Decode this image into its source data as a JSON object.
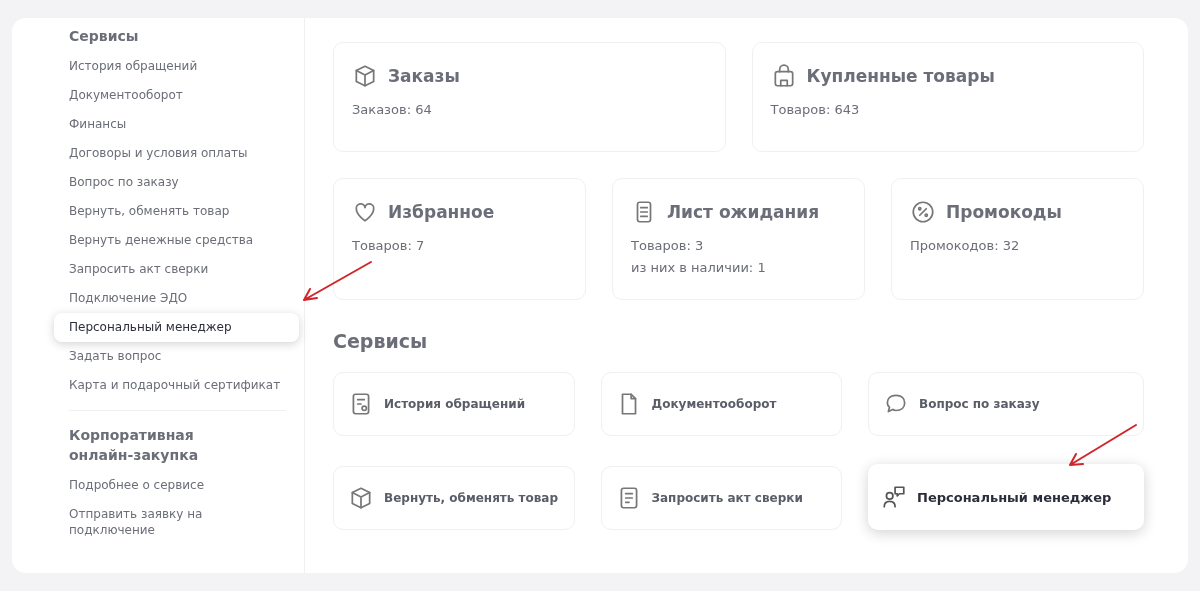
{
  "sidebar": {
    "groups": [
      {
        "title": "Сервисы",
        "highlighted": false,
        "items": [
          {
            "label": "История обращений",
            "highlighted": false
          },
          {
            "label": "Документооборот",
            "highlighted": false
          },
          {
            "label": "Финансы",
            "highlighted": false
          },
          {
            "label": "Договоры и условия оплаты",
            "highlighted": false
          },
          {
            "label": "Вопрос по заказу",
            "highlighted": false
          },
          {
            "label": "Вернуть, обменять товар",
            "highlighted": false
          },
          {
            "label": "Вернуть денежные средства",
            "highlighted": false
          },
          {
            "label": "Запросить акт сверки",
            "highlighted": false
          },
          {
            "label": "Подключение ЭДО",
            "highlighted": false
          },
          {
            "label": "Персональный менеджер",
            "highlighted": true
          },
          {
            "label": "Задать вопрос",
            "highlighted": false
          },
          {
            "label": "Карта и подарочный сертификат",
            "highlighted": false
          }
        ]
      },
      {
        "title": "Корпоративная онлайн-закупка",
        "highlighted": false,
        "items": [
          {
            "label": "Подробнее о сервисе",
            "highlighted": false
          },
          {
            "label": "Отправить заявку на подключение",
            "highlighted": false
          }
        ]
      }
    ]
  },
  "summary_cards": [
    {
      "title": "Заказы",
      "lines": [
        "Заказов: 64"
      ],
      "highlighted": false
    },
    {
      "title": "Купленные товары",
      "lines": [
        "Товаров: 643"
      ],
      "highlighted": false
    },
    {
      "title": "Избранное",
      "lines": [
        "Товаров: 7"
      ],
      "highlighted": false
    },
    {
      "title": "Лист ожидания",
      "lines": [
        "Товаров: 3",
        "из них в наличии: 1"
      ],
      "highlighted": false
    },
    {
      "title": "Промокоды",
      "lines": [
        "Промокодов: 32"
      ],
      "highlighted": false
    }
  ],
  "services": {
    "title": "Сервисы",
    "highlighted": false,
    "items": [
      {
        "label": "История обращений",
        "highlighted": false
      },
      {
        "label": "Документооборот",
        "highlighted": false
      },
      {
        "label": "Вопрос по заказу",
        "highlighted": false
      },
      {
        "label": "Вернуть, обменять товар",
        "highlighted": false
      },
      {
        "label": "Запросить акт сверки",
        "highlighted": false
      },
      {
        "label": "Персональный менеджер",
        "highlighted": true
      }
    ]
  }
}
